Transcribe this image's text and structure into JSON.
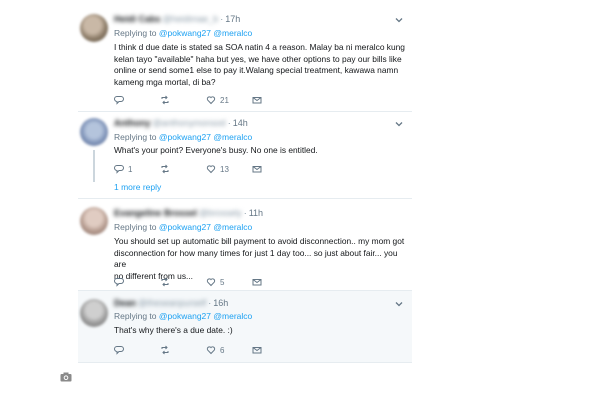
{
  "tweets": [
    {
      "name": "Heidi Cabs",
      "handle": "@heidimae_b",
      "time": "17h",
      "replying_prefix": "Replying to",
      "mention1": "@pokwang27",
      "mention2": "@meralco",
      "text_lines": [
        "I think d due date is stated sa SOA natin 4 a reason. Malay ba ni meralco kung",
        "kelan tayo \"available\" haha but yes, we have other options to pay our bills like",
        "online or send some1 else to pay it.Walang special treatment, kawawa namn",
        "kameng mga mortal, di ba?"
      ],
      "likes": "21",
      "replies": "",
      "retweets": "",
      "avatar_color": "#8a7a66"
    },
    {
      "name": "Anthony",
      "handle": "@anthonymonsod",
      "time": "14h",
      "replying_prefix": "Replying to",
      "mention1": "@pokwang27",
      "mention2": "@meralco",
      "text_lines": [
        "What's your point? Everyone's busy. No one is entitled."
      ],
      "replies": "1",
      "retweets": "",
      "likes": "13",
      "more_reply": "1 more reply",
      "avatar_color": "#7f93b8"
    },
    {
      "name": "Evangeline Brossel",
      "handle": "@brossely",
      "time": "11h",
      "replying_prefix": "Replying to",
      "mention1": "@pokwang27",
      "mention2": "@meralco",
      "text_lines": [
        "You should set up automatic bill payment to avoid disconnection.. my mom got",
        "disconnection for how many times for just 1 day too... so just about fair... you are",
        "no different from us..."
      ],
      "replies": "",
      "retweets": "",
      "likes": "5",
      "avatar_color": "#b49a8e"
    },
    {
      "name": "Dean",
      "handle": "@theseanpurself",
      "time": "16h",
      "replying_prefix": "Replying to",
      "mention1": "@pokwang27",
      "mention2": "@meralco",
      "text_lines": [
        "That's why there's a due date. :)"
      ],
      "replies": "",
      "retweets": "",
      "likes": "6",
      "avatar_color": "#9a9a9a"
    }
  ],
  "colors": {
    "link": "#1da1f2",
    "muted": "#657786",
    "border": "#e6ecf0",
    "shade": "#f5f8fa"
  },
  "icons": [
    "reply-icon",
    "retweet-icon",
    "like-icon",
    "message-icon",
    "chevron-down-icon",
    "camera-icon"
  ]
}
